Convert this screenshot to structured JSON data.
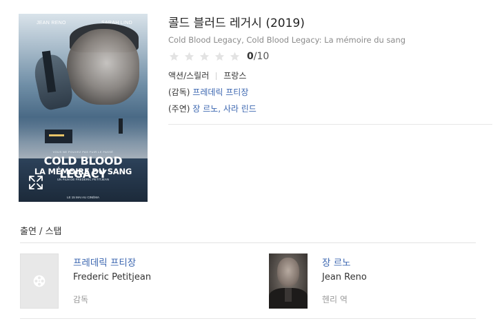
{
  "poster": {
    "actor_left": "JEAN RENO",
    "actor_right": "SARAH LIND",
    "tagline": "VOUS NE POUVEZ PAS FUIR LE PASSÉ",
    "title_line1": "COLD BLOOD LEGACY",
    "title_line2": "LA MÉMOIRE DU SANG",
    "director_line": "UN FILM DE FREDERIC PETITJEAN",
    "release_line": "LE 15 MAI AU CINÉMA"
  },
  "movie": {
    "title": "콜드 블러드 레거시 (2019)",
    "original_title": "Cold Blood Legacy, Cold Blood Legacy: La mémoire du sang",
    "rating": {
      "value": "0",
      "max": "/10",
      "stars_filled": 0,
      "stars_total": 5
    },
    "genre": "액션/스릴러",
    "country": "프랑스",
    "director_prefix": "(감독)",
    "director": "프레데릭 프티장",
    "cast_prefix": "(주연)",
    "cast": "장 르노, 사라 린드"
  },
  "section": {
    "title": "출연 / 스탭"
  },
  "people": [
    {
      "name_ko": "프레데릭 프티장",
      "name_en": "Frederic Petitjean",
      "role": "감독"
    },
    {
      "name_ko": "장 르노",
      "name_en": "Jean Reno",
      "role": "헨리 역"
    }
  ],
  "colors": {
    "link": "#3b66b0",
    "star_empty": "#e3e3e3",
    "muted_text": "#8a8a8a"
  }
}
